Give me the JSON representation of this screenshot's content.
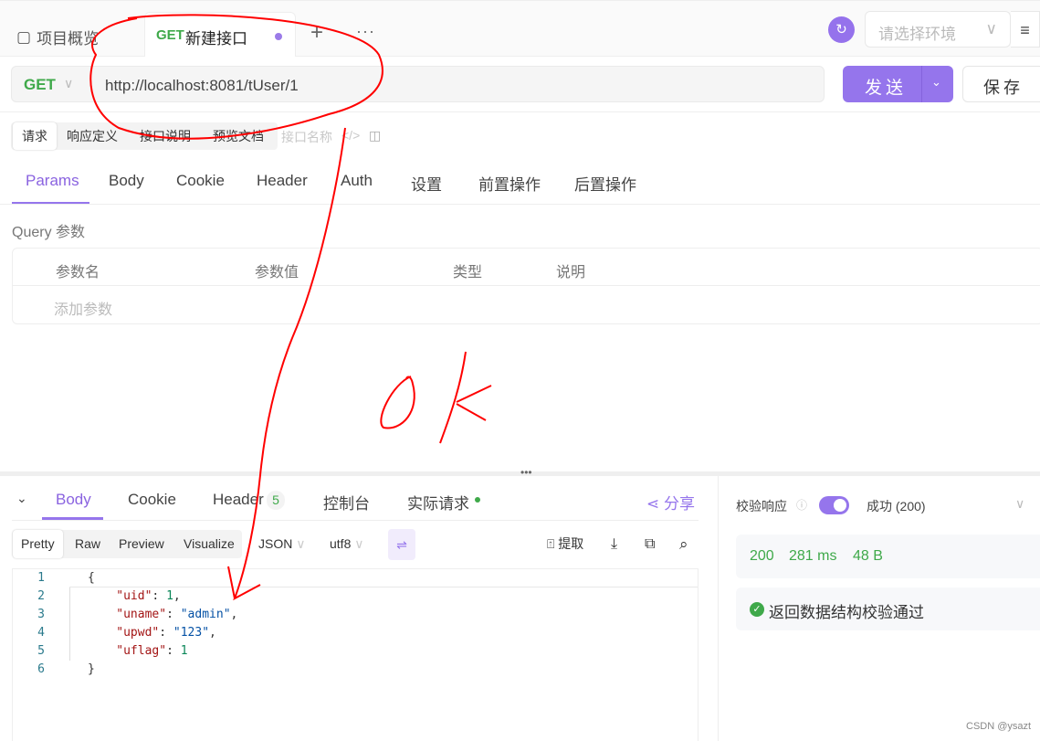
{
  "tabs": {
    "overview": "项目概览",
    "active_method": "GET",
    "active_title": "新建接口",
    "add": "+",
    "more": "···"
  },
  "env": {
    "placeholder": "请选择环境",
    "chevron": "∨",
    "menu": "≡",
    "sync_icon": "↻"
  },
  "request": {
    "method": "GET",
    "method_chevron": "∨",
    "url": "http://localhost:8081/tUser/1",
    "send": "发送",
    "send_chevron": "⌄",
    "save": "保存"
  },
  "segments": [
    "请求",
    "响应定义",
    "接口说明",
    "预览文档"
  ],
  "name_placeholder": "接口名称",
  "param_tabs": [
    "Params",
    "Body",
    "Cookie",
    "Header",
    "Auth",
    "设置",
    "前置操作",
    "后置操作"
  ],
  "query": {
    "label": "Query 参数",
    "columns": [
      "参数名",
      "参数值",
      "类型",
      "说明"
    ],
    "add": "添加参数"
  },
  "response": {
    "tabs": [
      "Body",
      "Cookie",
      "Header",
      "控制台",
      "实际请求"
    ],
    "header_count": "5",
    "share": "分享",
    "formats": [
      "Pretty",
      "Raw",
      "Preview",
      "Visualize"
    ],
    "lang": "JSON",
    "encoding": "utf8",
    "extract": "提取",
    "code": [
      {
        "n": "1",
        "parts": [
          [
            "p",
            "{"
          ]
        ]
      },
      {
        "n": "2",
        "parts": [
          [
            "p",
            "    "
          ],
          [
            "k",
            "\"uid\""
          ],
          [
            "p",
            ": "
          ],
          [
            "n",
            "1"
          ],
          [
            "p",
            ","
          ]
        ]
      },
      {
        "n": "3",
        "parts": [
          [
            "p",
            "    "
          ],
          [
            "k",
            "\"uname\""
          ],
          [
            "p",
            ": "
          ],
          [
            "s",
            "\"admin\""
          ],
          [
            "p",
            ","
          ]
        ]
      },
      {
        "n": "4",
        "parts": [
          [
            "p",
            "    "
          ],
          [
            "k",
            "\"upwd\""
          ],
          [
            "p",
            ": "
          ],
          [
            "s",
            "\"123\""
          ],
          [
            "p",
            ","
          ]
        ]
      },
      {
        "n": "5",
        "parts": [
          [
            "p",
            "    "
          ],
          [
            "k",
            "\"uflag\""
          ],
          [
            "p",
            ": "
          ],
          [
            "n",
            "1"
          ]
        ]
      },
      {
        "n": "6",
        "parts": [
          [
            "p",
            "}"
          ]
        ]
      }
    ]
  },
  "validate": {
    "label": "校验响应",
    "enabled": true,
    "status": "成功 (200)",
    "code": "200",
    "time": "281 ms",
    "size": "48 B",
    "result": "返回数据结构校验通过"
  },
  "annotation": {
    "text": "ok",
    "color": "#ff0000"
  },
  "watermark": "CSDN @ysazt",
  "colors": {
    "accent": "#9575ec",
    "success": "#3fa94a"
  }
}
